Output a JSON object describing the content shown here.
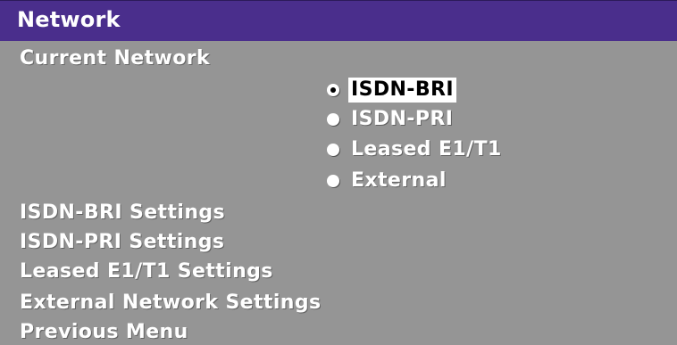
{
  "window": {
    "title": "Network"
  },
  "menu": {
    "current_network_label": "Current Network",
    "network_options": [
      {
        "label": "ISDN-BRI",
        "selected": true
      },
      {
        "label": "ISDN-PRI",
        "selected": false
      },
      {
        "label": "Leased E1/T1",
        "selected": false
      },
      {
        "label": "External",
        "selected": false
      }
    ],
    "items": [
      {
        "label": "ISDN-BRI Settings"
      },
      {
        "label": "ISDN-PRI Settings"
      },
      {
        "label": "Leased E1/T1 Settings"
      },
      {
        "label": "External Network Settings"
      },
      {
        "label": "Previous Menu"
      }
    ]
  },
  "colors": {
    "title_bar": "#4a2e8c",
    "background": "#959595",
    "text": "#ffffff",
    "highlight_bg": "#ffffff",
    "highlight_text": "#000000"
  }
}
